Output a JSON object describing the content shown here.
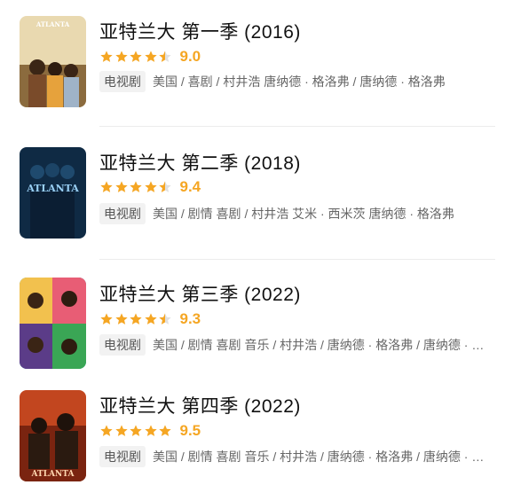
{
  "items": [
    {
      "title": "亚特兰大 第一季 (2016)",
      "stars": 4.5,
      "score": "9.0",
      "tag": "电视剧",
      "meta": "美国 / 喜剧 / 村井浩 唐纳德 · 格洛弗 / 唐纳德 · 格洛弗",
      "poster_text": "ATLANTA"
    },
    {
      "title": "亚特兰大 第二季 (2018)",
      "stars": 4.5,
      "score": "9.4",
      "tag": "电视剧",
      "meta": "美国 / 剧情 喜剧 / 村井浩 艾米 · 西米茨 唐纳德 · 格洛弗",
      "poster_text": "ATLANTA"
    },
    {
      "title": "亚特兰大 第三季 (2022)",
      "stars": 4.5,
      "score": "9.3",
      "tag": "电视剧",
      "meta": "美国 / 剧情 喜剧 音乐 / 村井浩 / 唐纳德 · 格洛弗 / 唐纳德 · 格洛弗",
      "poster_text": ""
    },
    {
      "title": "亚特兰大 第四季 (2022)",
      "stars": 5,
      "score": "9.5",
      "tag": "电视剧",
      "meta": "美国 / 剧情 喜剧 音乐 / 村井浩 / 唐纳德 · 格洛弗 / 唐纳德 · 格洛弗",
      "poster_text": "ATLANTA"
    }
  ],
  "colors": {
    "star": "#f5a623",
    "star_empty": "#e0e0e0"
  },
  "icons": {
    "star": "star-icon",
    "half_star": "half-star-icon"
  }
}
